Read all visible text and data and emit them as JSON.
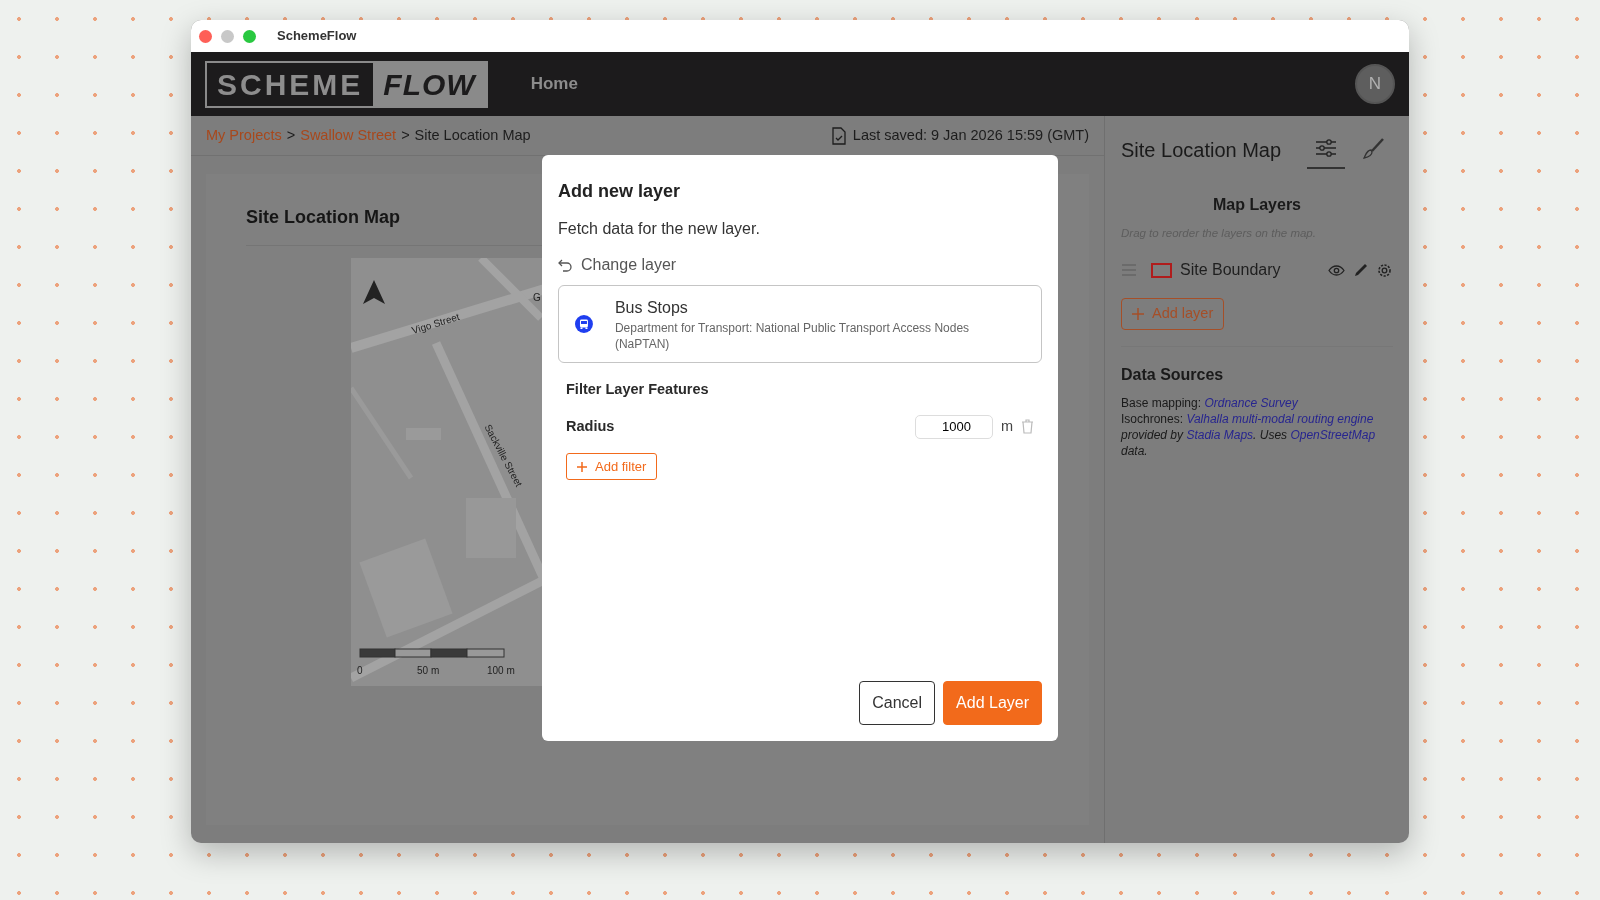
{
  "window": {
    "title": "SchemeFlow"
  },
  "navbar": {
    "logo_left": "SCHEME",
    "logo_right": "FLOW",
    "links": [
      {
        "label": "Home"
      }
    ],
    "avatar": "N"
  },
  "breadcrumb": [
    {
      "label": "My Projects",
      "kind": "link"
    },
    {
      "separator": ">",
      "label": "Swallow Street",
      "kind": "link"
    },
    {
      "separator": ">",
      "label": "Site Location Map",
      "kind": "current"
    }
  ],
  "last_saved": "Last saved: 9 Jan 2026 15:59 (GMT)",
  "page": {
    "title": "Site Location Map",
    "map": {
      "street_labels": [
        "Vigo Street",
        "Sackville Street",
        "G"
      ],
      "scale_labels": [
        "0",
        "50 m",
        "100 m"
      ]
    }
  },
  "side_panel": {
    "title": "Site Location Map",
    "tabs": [
      {
        "kind": "sliders",
        "selected": true
      },
      {
        "kind": "brush",
        "selected": false
      }
    ],
    "map_layers": {
      "title": "Map Layers",
      "hint": "Drag to reorder the layers on the map.",
      "layers": [
        {
          "name": "Site Boundary"
        }
      ],
      "add_button": "Add layer"
    },
    "data_sources": {
      "title": "Data Sources",
      "lines": [
        [
          {
            "kind": "text",
            "text": "Base mapping: "
          },
          {
            "kind": "link",
            "text": "Ordnance Survey"
          }
        ],
        [
          {
            "kind": "text",
            "text": "Isochrones: "
          },
          {
            "kind": "link",
            "text": "Valhalla multi-modal routing engine"
          },
          {
            "kind": "italic",
            "text": " provided by "
          },
          {
            "kind": "link",
            "text": "Stadia Maps"
          },
          {
            "kind": "italic",
            "text": ". Uses "
          },
          {
            "kind": "link",
            "text": "OpenStreetMap"
          },
          {
            "kind": "italic",
            "text": " data."
          }
        ]
      ]
    }
  },
  "modal": {
    "title": "Add new layer",
    "subtitle": "Fetch data for the new layer.",
    "change_link": "Change layer",
    "selected_layer": {
      "name": "Bus Stops",
      "description": "Department for Transport: National Public Transport Access Nodes (NaPTAN)"
    },
    "filter_title": "Filter Layer Features",
    "filters": [
      {
        "label": "Radius",
        "value": "1000",
        "unit": "m"
      }
    ],
    "add_filter": "Add filter",
    "buttons": [
      {
        "label": "Cancel",
        "kind": "secondary"
      },
      {
        "label": "Add Layer",
        "kind": "primary"
      }
    ]
  }
}
